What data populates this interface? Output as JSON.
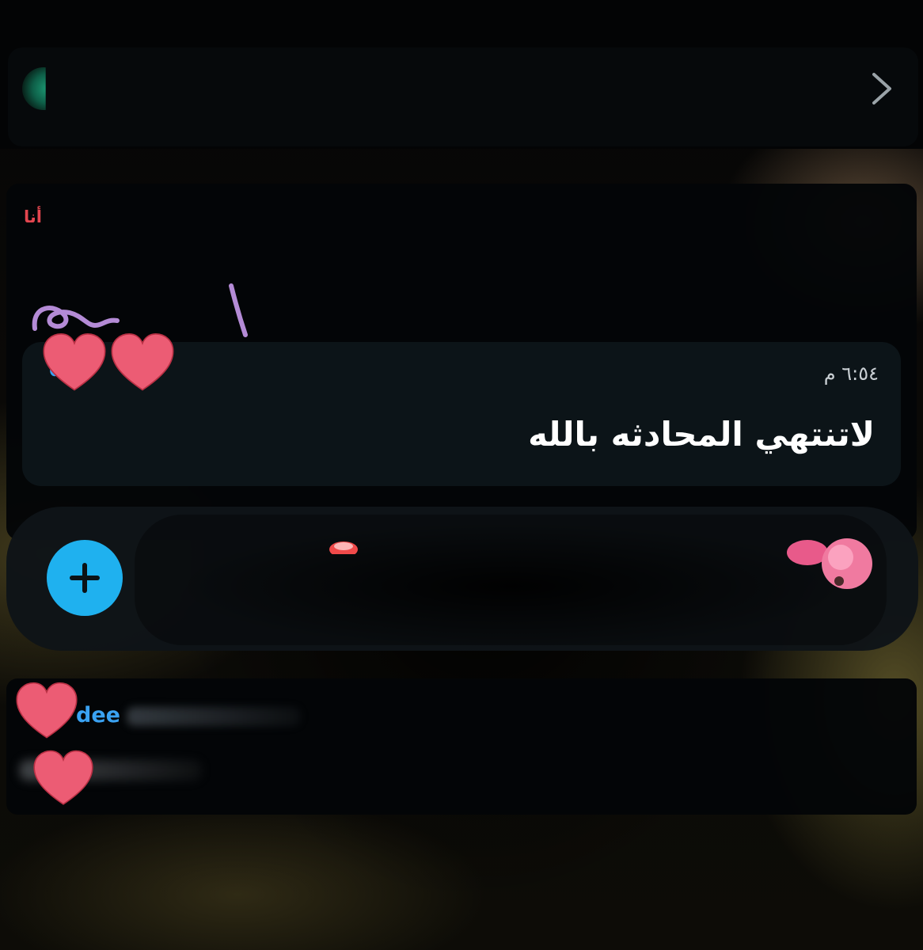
{
  "header": {
    "chevron_icon": "chevron-right-icon"
  },
  "message": {
    "sender_label": "أنا",
    "partial_name_visible": "d",
    "time": "٦:٥٤ م",
    "text": "لاتنتهي المحادثه بالله"
  },
  "composer": {
    "add_button_icon": "plus-icon",
    "reaction_icon": "heart-reaction-icon"
  },
  "chat_preview": {
    "partial_name": "dee"
  },
  "stickers": {
    "icon": "heart-sticker-icon",
    "color": "#ec5c74"
  },
  "colors": {
    "accent_blue": "#1fb1ef",
    "name_blue": "#3aa2f2",
    "sender_red": "#e3464f",
    "card_bg": "#0c1418"
  }
}
